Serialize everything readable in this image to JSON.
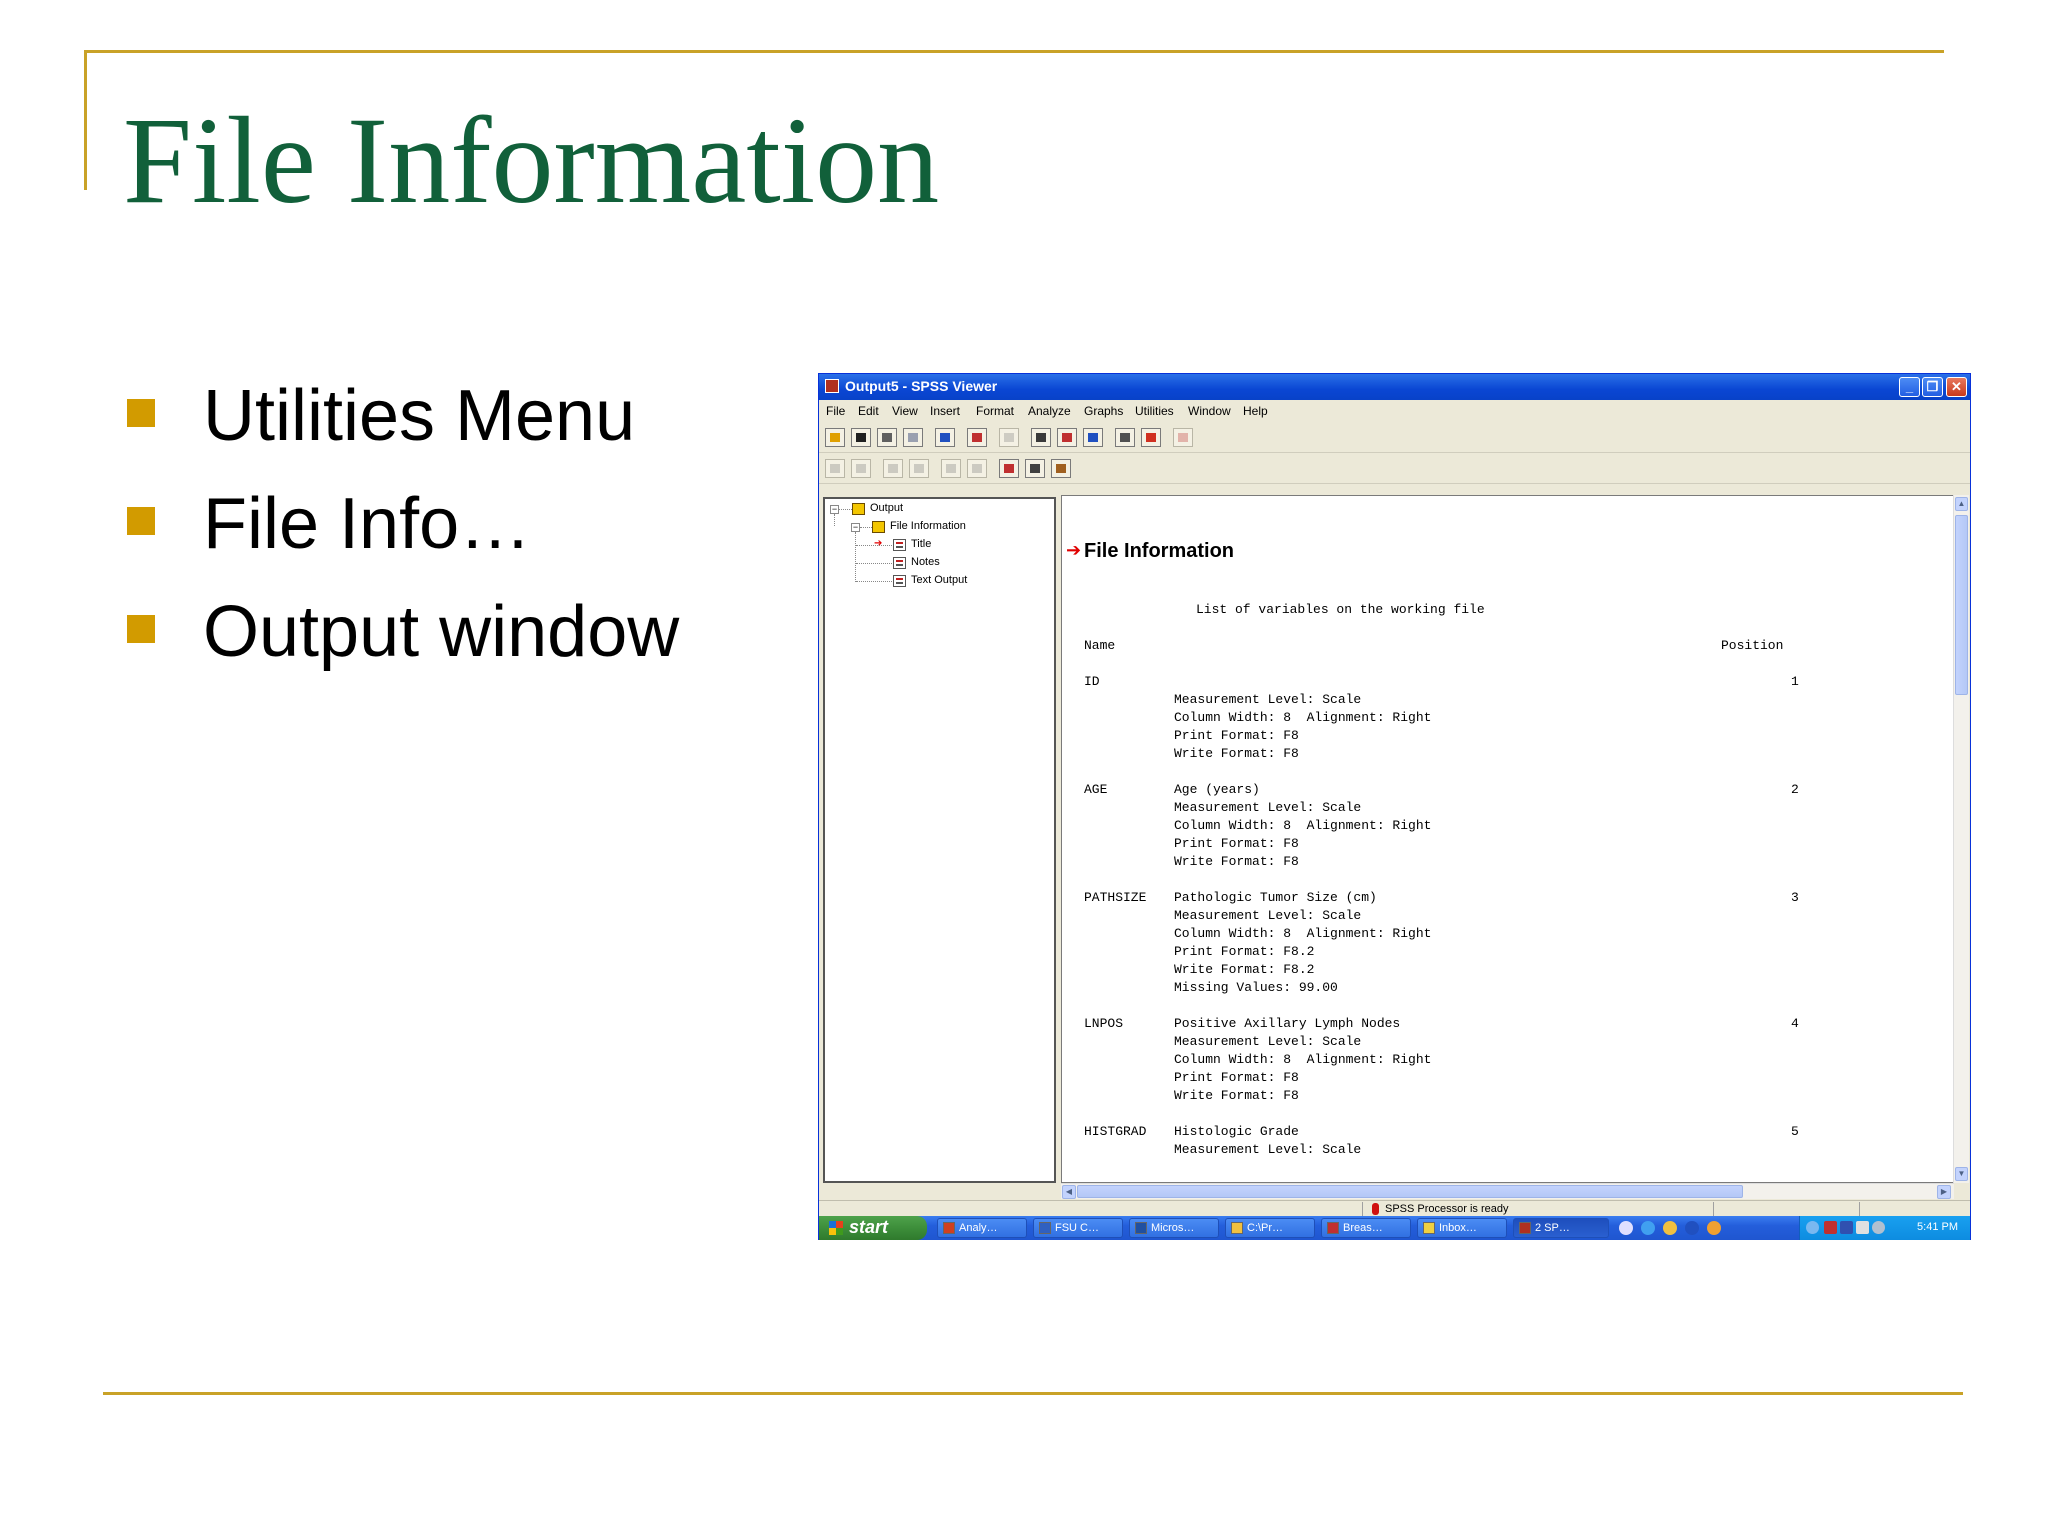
{
  "slide": {
    "title": "File Information",
    "bullets": [
      "Utilities Menu",
      "File Info…",
      "Output window"
    ],
    "colors": {
      "title": "#11603a",
      "rule": "#c9a227",
      "bullet": "#d29b00"
    }
  },
  "window": {
    "title": "Output5 - SPSS Viewer",
    "controls": {
      "minimize": "_",
      "restore": "❐",
      "close": "✕"
    },
    "menu": [
      "File",
      "Edit",
      "View",
      "Insert",
      "Format",
      "Analyze",
      "Graphs",
      "Utilities",
      "Window",
      "Help"
    ],
    "toolbar1_icons": [
      "open-icon",
      "save-icon",
      "print-icon",
      "print-preview-icon",
      "export-icon",
      "recall-dialog-icon",
      "undo-icon",
      "goto-data-icon",
      "goto-case-icon",
      "variables-icon",
      "use-sets-icon",
      "show-all-variables-icon",
      "spell-check-icon"
    ],
    "toolbar2_icons": [
      "back-icon",
      "forward-icon",
      "promote-icon",
      "demote-icon",
      "expand-icon",
      "collapse-icon",
      "show-icon",
      "hide-icon",
      "insert-heading-icon"
    ],
    "tree": {
      "root": "Output",
      "child": "File Information",
      "leaves": [
        "Title",
        "Notes",
        "Text Output"
      ]
    },
    "output": {
      "heading": "File Information",
      "subtitle": "List of variables on the working file",
      "col_name": "Name",
      "col_position": "Position",
      "variables": [
        {
          "name": "ID",
          "position": "1",
          "label": "",
          "lines": [
            "Measurement Level: Scale",
            "Column Width: 8  Alignment: Right",
            "Print Format: F8",
            "Write Format: F8"
          ]
        },
        {
          "name": "AGE",
          "position": "2",
          "label": "Age (years)",
          "lines": [
            "Measurement Level: Scale",
            "Column Width: 8  Alignment: Right",
            "Print Format: F8",
            "Write Format: F8"
          ]
        },
        {
          "name": "PATHSIZE",
          "position": "3",
          "label": "Pathologic Tumor Size (cm)",
          "lines": [
            "Measurement Level: Scale",
            "Column Width: 8  Alignment: Right",
            "Print Format: F8.2",
            "Write Format: F8.2",
            "Missing Values: 99.00"
          ]
        },
        {
          "name": "LNPOS",
          "position": "4",
          "label": "Positive Axillary Lymph Nodes",
          "lines": [
            "Measurement Level: Scale",
            "Column Width: 8  Alignment: Right",
            "Print Format: F8",
            "Write Format: F8"
          ]
        },
        {
          "name": "HISTGRAD",
          "position": "5",
          "label": "Histologic Grade",
          "lines": [
            "Measurement Level: Scale"
          ]
        }
      ]
    },
    "status": "SPSS Processor  is ready"
  },
  "taskbar": {
    "start": "start",
    "tasks": [
      "Analy…",
      "FSU C…",
      "Micros…",
      "C:\\Pr…",
      "Breas…",
      "Inbox…",
      "2 SP…"
    ],
    "time": "5:41 PM"
  }
}
